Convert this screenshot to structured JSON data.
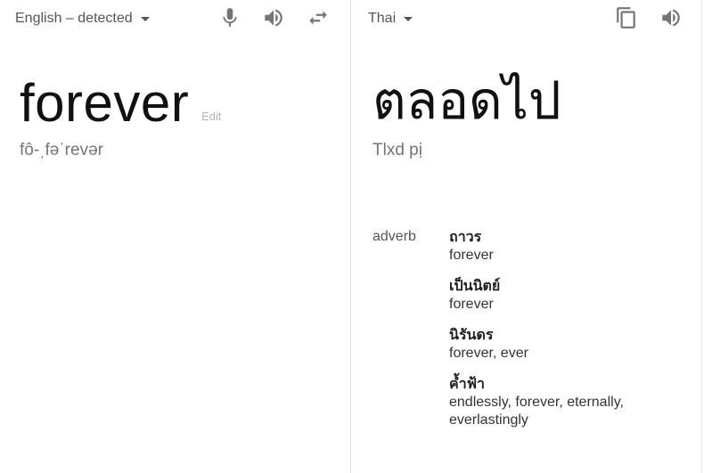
{
  "source": {
    "language": "English – detected",
    "text": "forever",
    "edit_label": "Edit",
    "transliteration": "fô-ˌfəˈrevər"
  },
  "target": {
    "language": "Thai",
    "text": "ตลอดไป",
    "transliteration": "Tlxd pị"
  },
  "dictionary": {
    "part_of_speech": "adverb",
    "entries": [
      {
        "word": "ถาวร",
        "reverse": "forever"
      },
      {
        "word": "เป็นนิตย์",
        "reverse": "forever"
      },
      {
        "word": "นิรันดร",
        "reverse": "forever, ever"
      },
      {
        "word": "ค้ำฟ้า",
        "reverse": "endlessly, forever, eternally, everlastingly"
      }
    ]
  },
  "icons": {
    "mic": "microphone-icon",
    "speaker_source": "speaker-icon",
    "swap": "swap-languages-icon",
    "copy": "copy-icon",
    "speaker_target": "speaker-icon"
  }
}
